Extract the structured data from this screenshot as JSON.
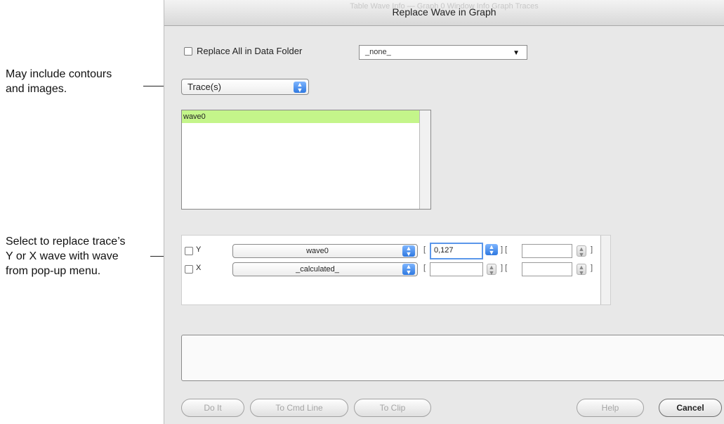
{
  "annotations": {
    "traces_note": [
      "May include contours",
      "and images."
    ],
    "wave_note": [
      "Select to replace trace’s",
      "Y or X wave with wave",
      "from pop-up menu."
    ]
  },
  "dialog": {
    "title": "Replace Wave in Graph",
    "background_title": "Table Wave Info — Graph 0 Window Info Graph Traces"
  },
  "replace_all": {
    "label": "Replace All in Data Folder",
    "checked": false,
    "folder_value": "_none_"
  },
  "type_popup": {
    "value": "Trace(s)"
  },
  "trace_list": {
    "items": [
      "wave0"
    ],
    "selected": "wave0"
  },
  "wave_rows": [
    {
      "axis": "Y",
      "checked": false,
      "wave": "wave0",
      "range_start": "0,127",
      "range_end": ""
    },
    {
      "axis": "X",
      "checked": false,
      "wave": "_calculated_",
      "range_start": "",
      "range_end": ""
    }
  ],
  "buttons": {
    "do_it": "Do It",
    "to_cmd_line": "To Cmd Line",
    "to_clip": "To Clip",
    "help": "Help",
    "cancel": "Cancel"
  },
  "colors": {
    "selection": "#c4f58a",
    "stepper_blue": "#3b82e6"
  },
  "icons": {
    "dropdown_arrow": "triangle-down",
    "stepper": "up-down-arrows"
  }
}
